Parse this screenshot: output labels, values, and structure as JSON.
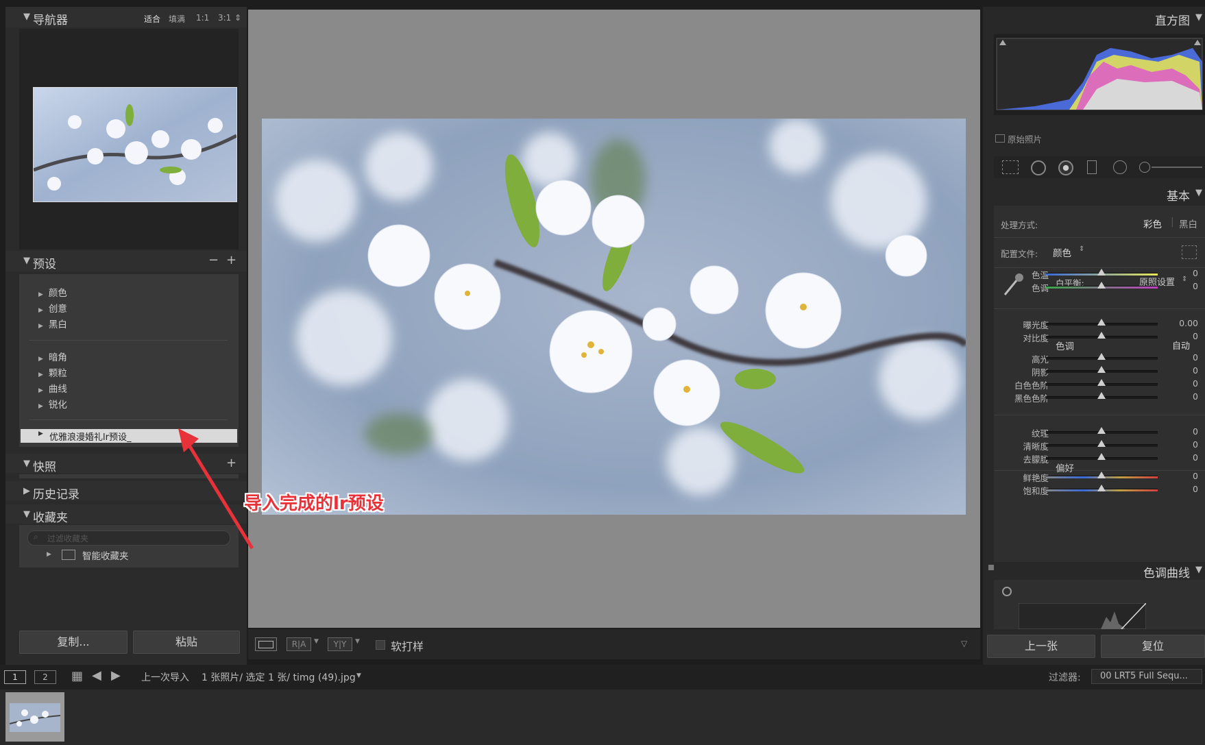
{
  "navigator": {
    "title": "导航器",
    "zoom_options": [
      "适合",
      "填满",
      "1:1",
      "3:1"
    ]
  },
  "presets": {
    "title": "预设",
    "group1": [
      "颜色",
      "创意",
      "黑白"
    ],
    "group2": [
      "暗角",
      "颗粒",
      "曲线",
      "锐化"
    ],
    "selected": "优雅浪漫婚礼lr预设_"
  },
  "snapshots": {
    "title": "快照"
  },
  "history": {
    "title": "历史记录"
  },
  "collections": {
    "title": "收藏夹",
    "search_placeholder": "过滤收藏夹",
    "smart": "智能收藏夹"
  },
  "left_buttons": {
    "copy": "复制...",
    "paste": "粘贴"
  },
  "annotation": "导入完成的lr预设",
  "toolbar": {
    "softproof": "软打样"
  },
  "histogram": {
    "title": "直方图",
    "original": "原始照片"
  },
  "basic": {
    "title": "基本",
    "treatment_label": "处理方式:",
    "treatment_color": "彩色",
    "treatment_bw": "黑白",
    "profile_label": "配置文件:",
    "profile_value": "颜色",
    "wb_label": "白平衡:",
    "wb_value": "原照设置",
    "temp": {
      "label": "色温",
      "value": "0"
    },
    "tint": {
      "label": "色调",
      "value": "0"
    },
    "tone_title": "色调",
    "auto": "自动",
    "exposure": {
      "label": "曝光度",
      "value": "0.00"
    },
    "contrast": {
      "label": "对比度",
      "value": "0"
    },
    "highlights": {
      "label": "高光",
      "value": "0"
    },
    "shadows": {
      "label": "阴影",
      "value": "0"
    },
    "whites": {
      "label": "白色色阶",
      "value": "0"
    },
    "blacks": {
      "label": "黑色色阶",
      "value": "0"
    },
    "presence_title": "偏好",
    "texture": {
      "label": "纹理",
      "value": "0"
    },
    "clarity": {
      "label": "清晰度",
      "value": "0"
    },
    "dehaze": {
      "label": "去朦胧",
      "value": "0"
    },
    "vibrance": {
      "label": "鲜艳度",
      "value": "0"
    },
    "saturation": {
      "label": "饱和度",
      "value": "0"
    }
  },
  "tone_curve": {
    "title": "色调曲线"
  },
  "right_buttons": {
    "prev": "上一张",
    "reset": "复位"
  },
  "filmbar": {
    "page1": "1",
    "page2": "2",
    "source": "上一次导入",
    "info": "1 张照片/ 选定 1 张/ timg (49).jpg",
    "filter_label": "过滤器:",
    "filter_value": "00 LRT5 Full Sequ..."
  },
  "colors": {
    "accent_red": "#e8323a",
    "panel": "#2b2b2b",
    "canvas": "#8a8a8a"
  }
}
